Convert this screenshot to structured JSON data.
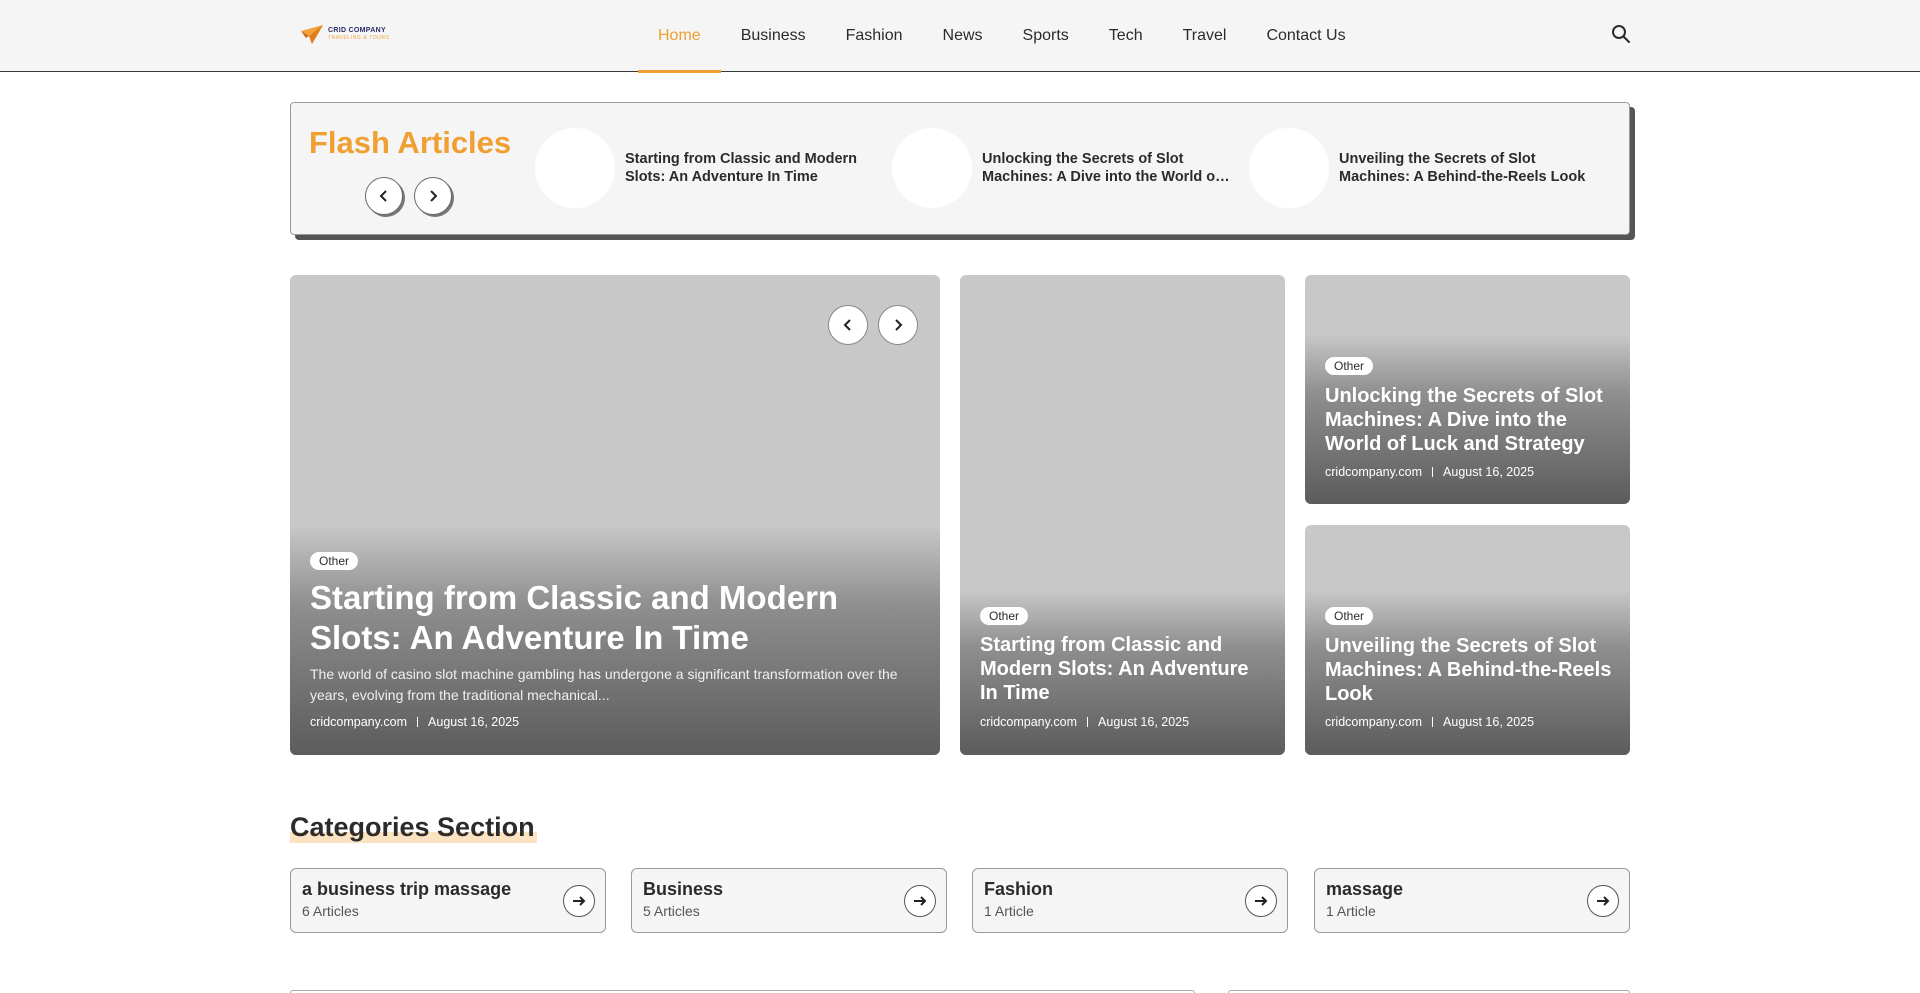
{
  "brand": {
    "name": "CRID COMPANY",
    "tagline": "TRAVELING & TOURS",
    "accent_color": "#f0a032"
  },
  "nav": {
    "items": [
      {
        "label": "Home",
        "active": true
      },
      {
        "label": "Business"
      },
      {
        "label": "Fashion"
      },
      {
        "label": "News"
      },
      {
        "label": "Sports"
      },
      {
        "label": "Tech"
      },
      {
        "label": "Travel"
      },
      {
        "label": "Contact Us"
      }
    ],
    "search_icon": "search-icon"
  },
  "flash": {
    "title": "Flash Articles",
    "items": [
      {
        "title": "Starting from Classic and Modern Slots: An Adventure In Time"
      },
      {
        "title": "Unlocking the Secrets of Slot Machines: A Dive into the World of Luck and Strategy"
      },
      {
        "title": "Unveiling the Secrets of Slot Machines: A Behind-the-Reels Look"
      }
    ]
  },
  "hero": {
    "main": {
      "badge": "Other",
      "title": "Starting from Classic and Modern Slots: An Adventure In Time",
      "excerpt": "The world of casino slot machine gambling has undergone a significant transformation over the years, evolving from the traditional mechanical...",
      "source": "cridcompany.com",
      "date": "August 16, 2025"
    },
    "side": [
      {
        "badge": "Other",
        "title": "Starting from Classic and Modern Slots: An Adventure In Time",
        "source": "cridcompany.com",
        "date": "August 16, 2025"
      },
      {
        "badge": "Other",
        "title": "Unlocking the Secrets of Slot Machines: A Dive into the World of Luck and Strategy",
        "source": "cridcompany.com",
        "date": "August 16, 2025"
      },
      {
        "badge": "Other",
        "title": "Unveiling the Secrets of Slot Machines: A Behind-the-Reels Look",
        "source": "cridcompany.com",
        "date": "August 16, 2025"
      }
    ]
  },
  "categories": {
    "heading": "Categories Section",
    "items": [
      {
        "name": "a business trip massage",
        "count": "6 Articles"
      },
      {
        "name": "Business",
        "count": "5 Articles"
      },
      {
        "name": "Fashion",
        "count": "1 Article"
      },
      {
        "name": "massage",
        "count": "1 Article"
      }
    ]
  }
}
